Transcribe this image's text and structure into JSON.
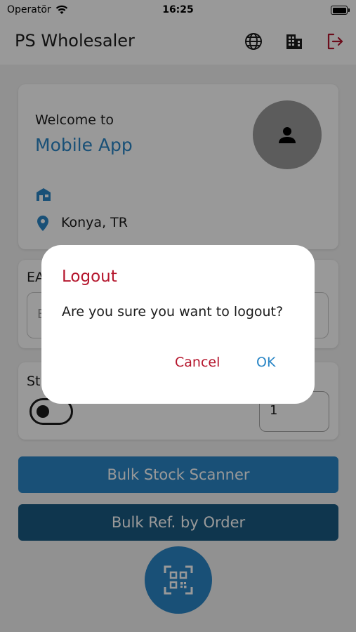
{
  "status_bar": {
    "carrier": "Operatör",
    "time": "16:25"
  },
  "header": {
    "title": "PS Wholesaler",
    "icons": [
      "globe-icon",
      "building-icon",
      "logout-icon"
    ]
  },
  "welcome": {
    "label": "Welcome to",
    "app_name": "Mobile App",
    "location": "Konya, TR"
  },
  "ean": {
    "label": "EA",
    "placeholder": "E"
  },
  "stock": {
    "label": "St",
    "toggle_on": false,
    "quantity": "1"
  },
  "buttons": {
    "bulk_stock": "Bulk Stock Scanner",
    "bulk_ref": "Bulk Ref. by Order"
  },
  "dialog": {
    "title": "Logout",
    "message": "Are you sure you want to logout?",
    "cancel_label": "Cancel",
    "ok_label": "OK"
  },
  "colors": {
    "primary": "#2a86c6",
    "primary_dark": "#1a5a82",
    "danger": "#b5162d"
  }
}
